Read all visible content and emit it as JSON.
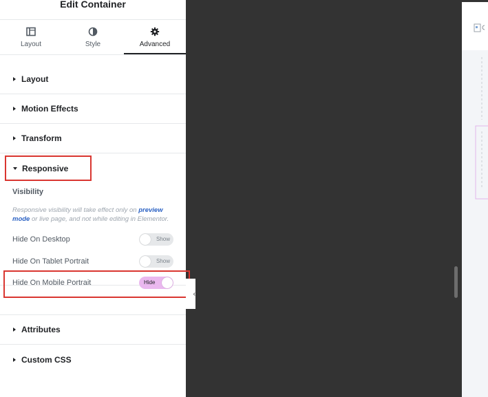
{
  "panel": {
    "title": "Edit Container",
    "tabs": [
      {
        "label": "Layout",
        "icon": "layout-icon"
      },
      {
        "label": "Style",
        "icon": "style-icon"
      },
      {
        "label": "Advanced",
        "icon": "gear-icon"
      }
    ],
    "active_tab": "Advanced",
    "sections_top": [
      "Layout",
      "Motion Effects",
      "Transform"
    ],
    "responsive": {
      "title": "Responsive",
      "visibility_title": "Visibility",
      "note": {
        "before": "Responsive visibility will take effect only on ",
        "link": "preview mode",
        "after": " or live page, and not while editing in Elementor."
      },
      "rows": [
        {
          "label": "Hide On Desktop",
          "state": "Show"
        },
        {
          "label": "Hide On Tablet Portrait",
          "state": "Show"
        },
        {
          "label": "Hide On Mobile Portrait",
          "state": "Hide"
        }
      ]
    },
    "sections_bottom": [
      "Attributes",
      "Custom CSS"
    ]
  },
  "collapse_glyph": "‹",
  "colors": {
    "accent_on": "#eab8ef",
    "highlight": "#d9352f",
    "link": "#2d63c4"
  }
}
